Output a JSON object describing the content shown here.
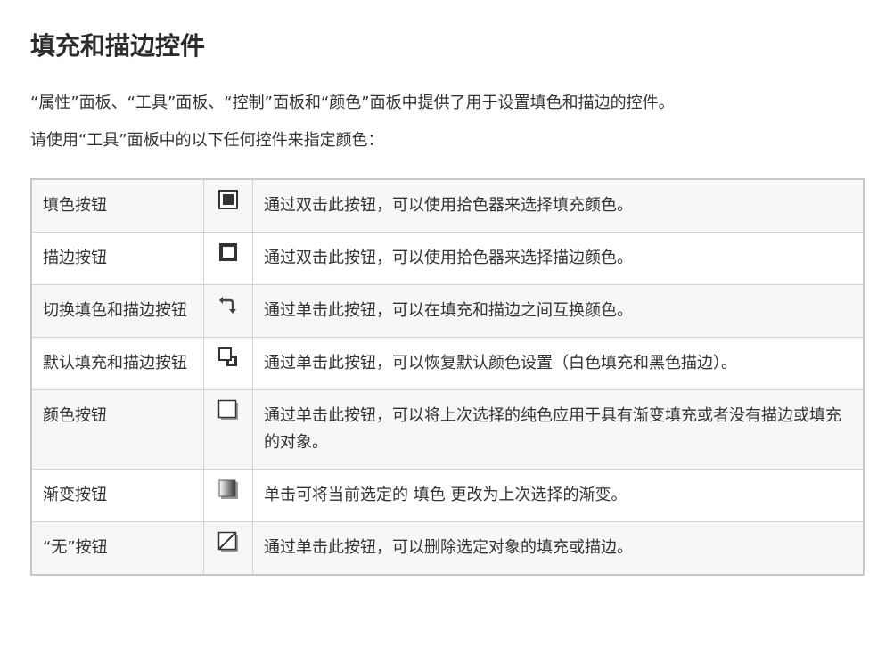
{
  "title": "填充和描边控件",
  "intro": "“属性”面板、“工具”面板、“控制”面板和“颜色”面板中提供了用于设置填色和描边的控件。",
  "instruction": "请使用“工具”面板中的以下任何控件来指定颜色：",
  "controls": [
    {
      "name": "填色按钮",
      "icon": "fill-icon",
      "description": "通过双击此按钮，可以使用拾色器来选择填充颜色。"
    },
    {
      "name": "描边按钮",
      "icon": "stroke-icon",
      "description": "通过双击此按钮，可以使用拾色器来选择描边颜色。"
    },
    {
      "name": "切换填色和描边按钮",
      "icon": "swap-icon",
      "description": "通过单击此按钮，可以在填充和描边之间互换颜色。"
    },
    {
      "name": "默认填充和描边按钮",
      "icon": "default-fill-stroke-icon",
      "description": "通过单击此按钮，可以恢复默认颜色设置（白色填充和黑色描边）。"
    },
    {
      "name": "颜色按钮",
      "icon": "color-icon",
      "description": "通过单击此按钮，可以将上次选择的纯色应用于具有渐变填充或者没有描边或填充的对象。"
    },
    {
      "name": "渐变按钮",
      "icon": "gradient-icon",
      "description": "单击可将当前选定的 填色 更改为上次选择的渐变。"
    },
    {
      "name": "“无”按钮",
      "icon": "none-icon",
      "description": "通过单击此按钮，可以删除选定对象的填充或描边。"
    }
  ]
}
